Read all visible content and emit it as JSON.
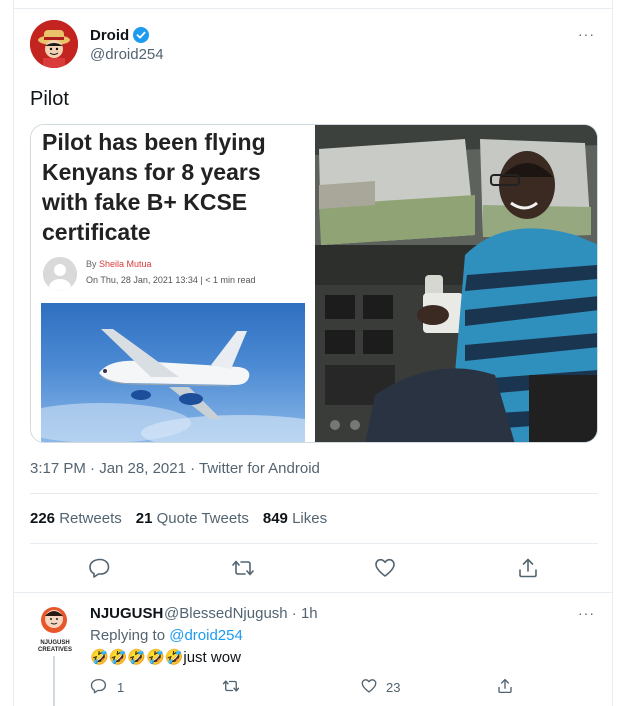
{
  "tweet": {
    "author_name": "Droid",
    "author_handle": "@droid254",
    "text": "Pilot",
    "timestamp": "3:17 PM · Jan 28, 2021 · Twitter for Android",
    "more_label": "···"
  },
  "media": {
    "headline": "Pilot has been flying Kenyans for 8 years with fake B+ KCSE certificate",
    "byline_prefix": "By",
    "byline_author": "Sheila Mutua",
    "byline_date": "On Thu, 28 Jan, 2021 13:34 | < 1 min read"
  },
  "stats": {
    "retweets_count": "226",
    "retweets_label": "Retweets",
    "quotes_count": "21",
    "quotes_label": "Quote Tweets",
    "likes_count": "849",
    "likes_label": "Likes"
  },
  "reply": {
    "author_name": "NJUGUSH",
    "handle_time": "@BlessedNjugush · 1h",
    "replying_prefix": "Replying to",
    "replying_to": "@droid254",
    "text": "🤣🤣🤣🤣🤣just wow",
    "logo_text_line1": "NJUGUSH",
    "logo_text_line2": "CREATIVES",
    "reply_count": "1",
    "like_count": "23",
    "more_label": "···"
  },
  "colors": {
    "accent": "#1d9bf0",
    "muted": "#536471",
    "border": "#e6ecf0"
  },
  "icons": [
    "verified-badge-icon",
    "more-icon",
    "reply-icon",
    "retweet-icon",
    "like-icon",
    "share-icon"
  ]
}
